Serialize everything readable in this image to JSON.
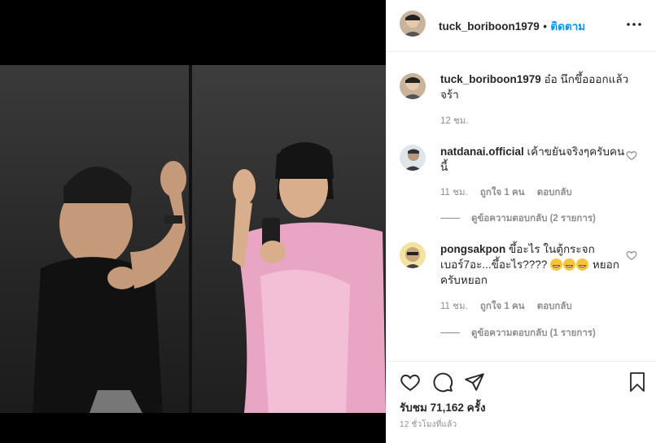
{
  "header": {
    "username": "tuck_boriboon1979",
    "separator": "•",
    "follow_label": "ติดตาม",
    "more_icon": "more-horizontal-icon"
  },
  "caption": {
    "username": "tuck_boriboon1979",
    "text": "อ๋อ นึกขึ้อออกแล้วจร้า",
    "time": "12 ชม."
  },
  "comments": [
    {
      "username": "natdanai.official",
      "text": "เค้าขยันจริงๆครับคนนี้",
      "time": "11 ชม.",
      "likes": "ถูกใจ 1 คน",
      "reply": "ตอบกลับ",
      "view_replies": "ดูข้อความตอบกลับ (2 รายการ)"
    },
    {
      "username": "pongsakpon",
      "text_before": "ขึ้อะไร ในตู้กระจกเบอร์7อะ...ขึ้อะไร????",
      "text_after": "หยอกครับหยอก",
      "emoji_count": 3,
      "time": "11 ชม.",
      "likes": "ถูกใจ 1 คน",
      "reply": "ตอบกลับ",
      "view_replies": "ดูข้อความตอบกลับ (1 รายการ)"
    }
  ],
  "actions": {
    "like_icon": "heart-icon",
    "comment_icon": "comment-icon",
    "share_icon": "share-icon",
    "save_icon": "bookmark-icon",
    "likes_text": "รับชม 71,162 ครั้ง",
    "timestamp": "12 ชั่วโมงที่แล้ว"
  },
  "colors": {
    "link": "#0095f6",
    "muted": "#8e8e8e",
    "text": "#262626",
    "robe": "#e9a6c4"
  }
}
